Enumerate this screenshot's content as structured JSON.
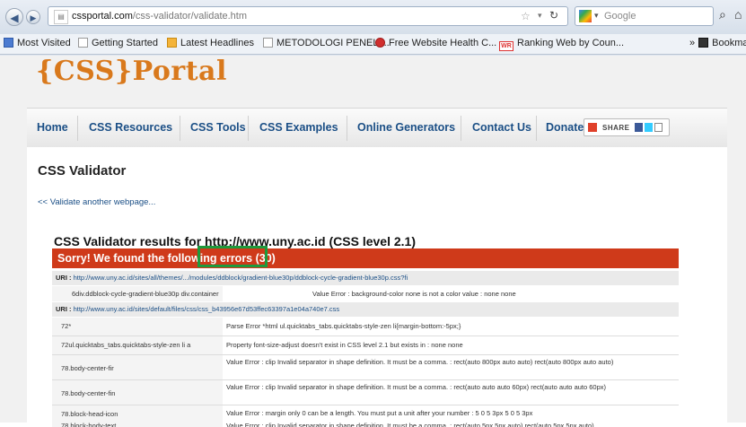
{
  "browser": {
    "url_domain": "cssportal.com",
    "url_path": "/css-validator/validate.htm",
    "search_placeholder": "Google",
    "bookmarks": [
      {
        "label": "Most Visited"
      },
      {
        "label": "Getting Started"
      },
      {
        "label": "Latest Headlines"
      },
      {
        "label": "METODOLOGI PENELI..."
      },
      {
        "label": "Free Website Health C..."
      },
      {
        "label": "Ranking Web by Coun..."
      }
    ],
    "bookmarks_menu": "Bookmar"
  },
  "site": {
    "logo": "{CSS}Portal",
    "nav": [
      "Home",
      "CSS Resources",
      "CSS Tools",
      "CSS Examples",
      "Online Generators",
      "Contact Us",
      "Donate"
    ],
    "share_label": "SHARE"
  },
  "validator": {
    "title": "CSS Validator",
    "validate_another": "<< Validate another webpage...",
    "results_title": "CSS Validator results for http://www.uny.ac.id (CSS level 2.1)",
    "error_banner": "Sorry! We found the following errors (30)",
    "uri_label": "URI :",
    "uri1": "http://www.uny.ac.id/sites/all/themes/.../modules/ddblock/gradient-blue30p/ddblock-cycle-gradient-blue30p.css?fi",
    "row1_left": "6div.ddblock-cycle-gradient-blue30p div.container",
    "row1_right": "Value Error : background-color none is not a color value : none none",
    "uri2": "http://www.uny.ac.id/sites/default/files/css/css_b43956e67d53ffec63397a1e04a740e7.css",
    "rows": [
      {
        "left": "72*",
        "right": "Parse Error *html ul.quicktabs_tabs.quicktabs-style-zen li{margin-bottom:-5px;}"
      },
      {
        "left": "72ul.quicktabs_tabs.quicktabs-style-zen li a",
        "right": "Property font-size-adjust doesn't exist in CSS level 2.1 but exists in : none none"
      },
      {
        "left": "78.body-center-fir",
        "right": "Value Error : clip Invalid separator in shape definition. It must be a comma. : rect(auto 800px auto auto) rect(auto 800px auto auto)"
      },
      {
        "left": "78.body-center-fin",
        "right": "Value Error : clip Invalid separator in shape definition. It must be a comma. : rect(auto auto auto 60px) rect(auto auto auto 60px)"
      },
      {
        "left": "78.block-head-icon",
        "right": "Value Error : margin only 0 can be a length. You must put a unit after your number : 5 0 5 3px 5 0 5 3px"
      },
      {
        "left": "78.block-body-text",
        "right": "Value Error : clip Invalid separator in shape definition. It must be a comma. : rect(auto 5px 5px auto) rect(auto 5px 5px auto)"
      }
    ]
  }
}
